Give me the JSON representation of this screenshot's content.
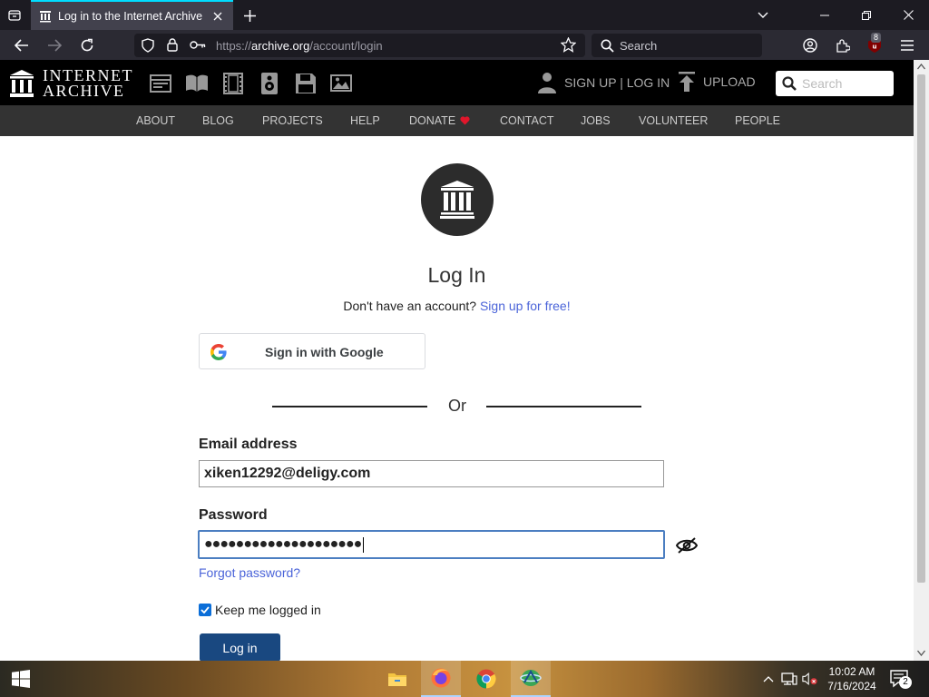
{
  "browser": {
    "tab_title": "Log in to the Internet Archive",
    "url_prefix": "https://",
    "url_host": "archive.org",
    "url_path": "/account/login",
    "search_placeholder": "Search",
    "extension_badge": "8"
  },
  "ia_header": {
    "logo_line1": "INTERNET",
    "logo_line2": "ARCHIVE",
    "media_icons": [
      "web-icon",
      "texts-icon",
      "video-icon",
      "audio-icon",
      "software-icon",
      "images-icon"
    ],
    "signup_login": "SIGN UP | LOG IN",
    "upload": "UPLOAD",
    "search_placeholder": "Search"
  },
  "ia_nav": {
    "items": [
      "ABOUT",
      "BLOG",
      "PROJECTS",
      "HELP",
      "DONATE",
      "CONTACT",
      "JOBS",
      "VOLUNTEER",
      "PEOPLE"
    ]
  },
  "login": {
    "title": "Log In",
    "no_account": "Don't have an account?",
    "signup_link": "Sign up for free!",
    "google_button": "Sign in with Google",
    "or": "Or",
    "email_label": "Email address",
    "email_value": "xiken12292@deligy.com",
    "password_label": "Password",
    "password_value": "●●●●●●●●●●●●●●●●●●●●",
    "forgot": "Forgot password?",
    "keep_logged_in": "Keep me logged in",
    "keep_logged_in_checked": true,
    "login_button": "Log in"
  },
  "taskbar": {
    "apps": [
      "file-explorer-icon",
      "firefox-icon",
      "chrome-icon",
      "network-app-icon"
    ],
    "time": "10:02 AM",
    "date": "7/16/2024",
    "notification_count": "2"
  },
  "colors": {
    "link": "#4b64d9",
    "login_button": "#194880",
    "donate_heart": "#e0162b",
    "focus_border": "#4b7ec1"
  }
}
